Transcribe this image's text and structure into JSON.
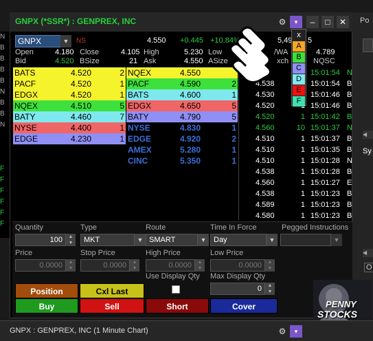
{
  "window": {
    "title": "GNPX (*SSR*) : GENPREX, INC",
    "purple_btn": "▾"
  },
  "left_strip": [
    "N",
    "B",
    "B",
    "B",
    "B",
    "N",
    "B",
    "B",
    "N",
    "",
    "",
    "",
    "F",
    "F",
    "F",
    "F",
    "F",
    "F"
  ],
  "quote": {
    "symbol": "GNPX",
    "ns": "NS",
    "last": "4.550",
    "change": "+0.445",
    "pct": "+10.84%",
    "right_hdr1": "5,49",
    "right_hdr1b": "5",
    "open_label": "Open",
    "open": "4.180",
    "close_label": "Close",
    "close": "4.105",
    "high_label": "High",
    "high": "5.230",
    "low_label": "Low",
    "vwap_label": "/WA",
    "vwap_val": "4.789",
    "bid_label": "Bid",
    "bid": "4.520",
    "bsize_label": "BSize",
    "bsize": "21",
    "ask_label": "Ask",
    "ask": "4.550",
    "asize_label": "ASize",
    "exch_label": "xch",
    "nqsc_label": "NQSC"
  },
  "bids": [
    {
      "mm": "BATS",
      "price": "4.520",
      "size": "2",
      "bg": "#f5f32c",
      "fg": "#000"
    },
    {
      "mm": "PACF",
      "price": "4.520",
      "size": "1",
      "bg": "#f5f32c",
      "fg": "#000"
    },
    {
      "mm": "EDGX",
      "price": "4.520",
      "size": "1",
      "bg": "#f5f32c",
      "fg": "#000"
    },
    {
      "mm": "NQEX",
      "price": "4.510",
      "size": "5",
      "bg": "#3ee03b",
      "fg": "#000"
    },
    {
      "mm": "BATY",
      "price": "4.460",
      "size": "7",
      "bg": "#7ee8ee",
      "fg": "#000"
    },
    {
      "mm": "NYSE",
      "price": "4.400",
      "size": "1",
      "bg": "#f06565",
      "fg": "#000"
    },
    {
      "mm": "EDGE",
      "price": "4.230",
      "size": "1",
      "bg": "#8f8ff6",
      "fg": "#000"
    }
  ],
  "asks": [
    {
      "mm": "NQEX",
      "price": "4.550",
      "size": "",
      "bg": "#f5f32c",
      "fg": "#000"
    },
    {
      "mm": "PACF",
      "price": "4.590",
      "size": "2",
      "bg": "#3ee03b",
      "fg": "#000"
    },
    {
      "mm": "BATS",
      "price": "4.600",
      "size": "1",
      "bg": "#7ee8ee",
      "fg": "#000"
    },
    {
      "mm": "EDGX",
      "price": "4.650",
      "size": "5",
      "bg": "#f06565",
      "fg": "#000"
    },
    {
      "mm": "BATY",
      "price": "4.790",
      "size": "5",
      "bg": "#8f8ff6",
      "fg": "#000"
    },
    {
      "mm": "NYSE",
      "price": "4.830",
      "size": "1",
      "bg": "#000",
      "fg": "#3b6fd6"
    },
    {
      "mm": "EDGE",
      "price": "4.920",
      "size": "2",
      "bg": "#000",
      "fg": "#3b6fd6"
    },
    {
      "mm": "AMEX",
      "price": "5.280",
      "size": "1",
      "bg": "#000",
      "fg": "#3b6fd6"
    },
    {
      "mm": "CINC",
      "price": "5.350",
      "size": "1",
      "bg": "#000",
      "fg": "#3b6fd6"
    }
  ],
  "trades": [
    {
      "price": "",
      "size": "",
      "time": "15:01:54",
      "ex": "N",
      "color": "#2ecc40"
    },
    {
      "price": "4.538",
      "size": "1",
      "time": "15:01:54",
      "ex": "B",
      "color": "#fff"
    },
    {
      "price": "4.530",
      "size": "1",
      "time": "15:01:46",
      "ex": "B",
      "color": "#fff"
    },
    {
      "price": "4.520",
      "size": "1",
      "time": "15:01:46",
      "ex": "B",
      "color": "#fff"
    },
    {
      "price": "4.520",
      "size": "1",
      "time": "15:01:42",
      "ex": "B",
      "color": "#2ecc40"
    },
    {
      "price": "4.560",
      "size": "10",
      "time": "15:01:37",
      "ex": "N",
      "color": "#2ecc40"
    },
    {
      "price": "4.510",
      "size": "1",
      "time": "15:01:37",
      "ex": "B",
      "color": "#fff"
    },
    {
      "price": "4.510",
      "size": "1",
      "time": "15:01:35",
      "ex": "B",
      "color": "#fff"
    },
    {
      "price": "4.510",
      "size": "1",
      "time": "15:01:28",
      "ex": "N",
      "color": "#fff"
    },
    {
      "price": "4.538",
      "size": "1",
      "time": "15:01:28",
      "ex": "B",
      "color": "#fff"
    },
    {
      "price": "4.560",
      "size": "1",
      "time": "15:01:27",
      "ex": "E",
      "color": "#fff"
    },
    {
      "price": "4.538",
      "size": "1",
      "time": "15:01:23",
      "ex": "B",
      "color": "#fff"
    },
    {
      "price": "4.589",
      "size": "1",
      "time": "15:01:23",
      "ex": "B",
      "color": "#fff"
    },
    {
      "price": "4.580",
      "size": "1",
      "time": "15:01:23",
      "ex": "B",
      "color": "#fff"
    }
  ],
  "letters": [
    {
      "t": "x",
      "bg": "#222",
      "fg": "#fff"
    },
    {
      "t": "A",
      "bg": "#f5a623",
      "fg": "#000"
    },
    {
      "t": "B",
      "bg": "#3ee03b",
      "fg": "#000"
    },
    {
      "t": "C",
      "bg": "#8f8ff6",
      "fg": "#000"
    },
    {
      "t": "D",
      "bg": "#7ee8ee",
      "fg": "#000"
    },
    {
      "t": "E",
      "bg": "#f01010",
      "fg": "#000"
    },
    {
      "t": "F",
      "bg": "#3ee0b0",
      "fg": "#000"
    }
  ],
  "order": {
    "quantity_label": "Quantity",
    "quantity": "100",
    "type_label": "Type",
    "type": "MKT",
    "route_label": "Route",
    "route": "SMART",
    "tif_label": "Time In Force",
    "tif": "Day",
    "pegged_label": "Pegged Instructions",
    "pegged": "",
    "price_label": "Price",
    "price": "0.0000",
    "stop_label": "Stop Price",
    "stop": "0.0000",
    "high_label": "High Price",
    "high": "0.0000",
    "low_label": "Low Price",
    "low": "0.0000",
    "display_qty_label": "Use Display Qty",
    "max_display_label": "Max Display Qty",
    "max_display": "0",
    "position_btn": "Position",
    "cxl_btn": "Cxl Last",
    "buy_btn": "Buy",
    "sell_btn": "Sell",
    "short_btn": "Short",
    "cover_btn": "Cover"
  },
  "bottom": {
    "title": "GNPX : GENPREX, INC (1 Minute Chart)"
  },
  "right_panel": {
    "title": "Po",
    "sy": "Sy",
    "o": "O"
  },
  "penny": {
    "line1": "PENNY",
    "line2": "STOCKS"
  }
}
